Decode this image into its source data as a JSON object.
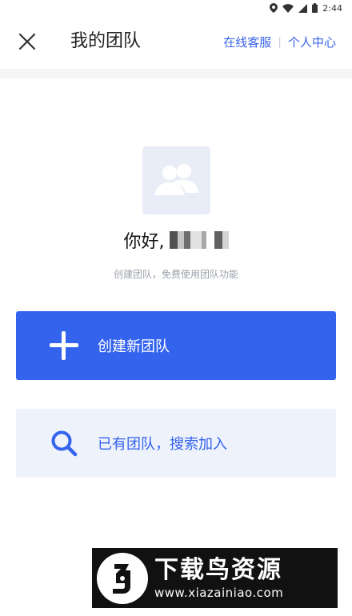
{
  "status_bar": {
    "time": "2:44"
  },
  "header": {
    "title": "我的团队",
    "links": [
      "在线客服",
      "个人中心"
    ]
  },
  "greeting": {
    "prefix": "你好,"
  },
  "subtitle": "创建团队，免费使用团队功能",
  "actions": {
    "create_label": "创建新团队",
    "join_label": "已有团队，搜索加入"
  },
  "watermark": {
    "title": "下载鸟资源",
    "url": "www.xiazainiao.com"
  },
  "colors": {
    "accent": "#3463ee",
    "link": "#3a63e8",
    "join_bg": "#eef2fb"
  }
}
